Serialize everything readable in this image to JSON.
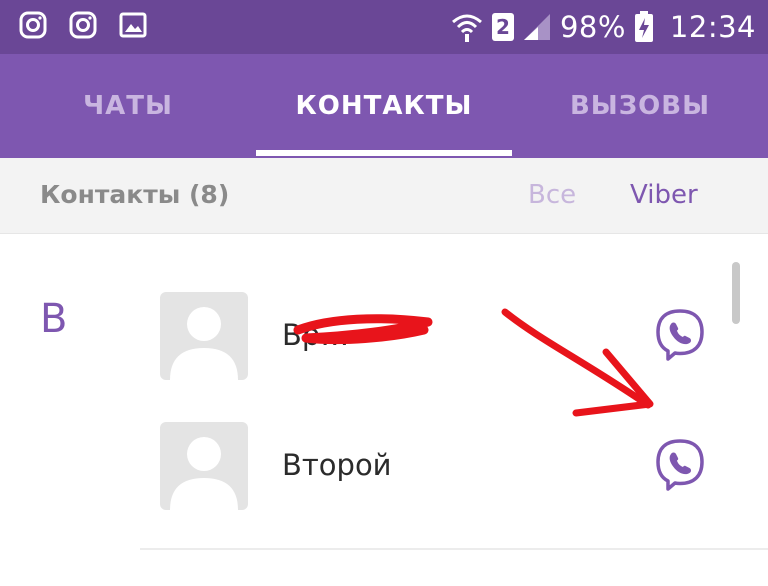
{
  "status_bar": {
    "left_icons": [
      "instagram-icon",
      "instagram-icon",
      "gallery-icon"
    ],
    "sim_slot": "2",
    "battery": "98%",
    "time": "12:34"
  },
  "tabs": [
    {
      "label": "ЧАТЫ",
      "active": false
    },
    {
      "label": "КОНТАКТЫ",
      "active": true
    },
    {
      "label": "ВЫЗОВЫ",
      "active": false
    }
  ],
  "filter_bar": {
    "title": "Контакты (8)",
    "all_label": "Все",
    "viber_label": "Viber"
  },
  "contacts": {
    "section_letter": "В",
    "items": [
      {
        "name": "Вр…",
        "redacted": true,
        "icon": "viber-call-icon"
      },
      {
        "name": "Второй",
        "redacted": false,
        "icon": "viber-call-icon"
      }
    ]
  },
  "colors": {
    "status_bar": "#6a4796",
    "tab_bar": "#7e57b0",
    "accent": "#7e57b0",
    "annotation": "#e8141b"
  }
}
